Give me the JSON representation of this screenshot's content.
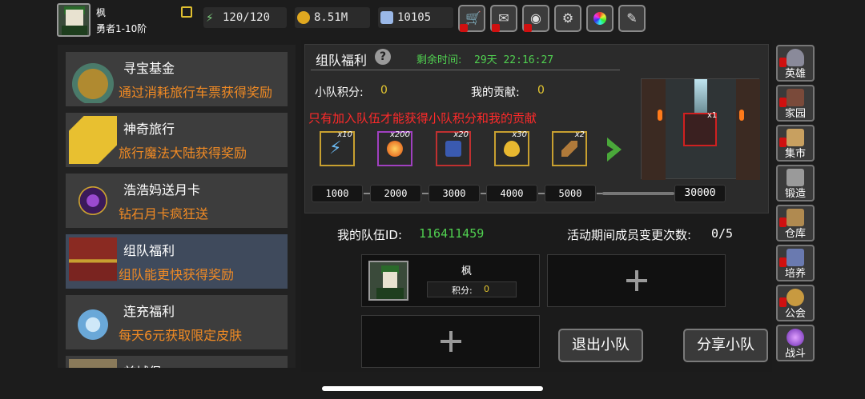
{
  "player": {
    "name": "枫",
    "rank": "勇者1-10阶"
  },
  "resources": {
    "energy": "120/120",
    "gold": "8.51M",
    "gems": "10105"
  },
  "colors": {
    "accent_orange": "#f08a24",
    "green": "#50d050",
    "gold": "#e6c830",
    "red": "#ff2a2a"
  },
  "sidebar": {
    "items": [
      {
        "title": "寻宝基金",
        "desc": "通过消耗旅行车票获得奖励"
      },
      {
        "title": "神奇旅行",
        "desc": "旅行魔法大陆获得奖励"
      },
      {
        "title": "浩浩妈送月卡",
        "desc": "钻石月卡疯狂送"
      },
      {
        "title": "组队福利",
        "desc": "组队能更快获得奖励"
      },
      {
        "title": "连充福利",
        "desc": "每天6元获取限定皮肤"
      },
      {
        "title": "首城堡",
        "desc": ""
      }
    ]
  },
  "panel": {
    "title": "组队福利",
    "timer_label": "剩余时间:",
    "timer": "29天 22:16:27",
    "team_score_label": "小队积分:",
    "team_score": "0",
    "my_contrib_label": "我的贡献:",
    "my_contrib": "0",
    "warning": "只有加入队伍才能获得小队积分和我的贡献",
    "rewards": [
      {
        "icon": "lightning-icon",
        "count": "x10"
      },
      {
        "icon": "fire-orb-icon",
        "count": "x200"
      },
      {
        "icon": "blue-gem-icon",
        "count": "x20"
      },
      {
        "icon": "golden-egg-icon",
        "count": "x30"
      },
      {
        "icon": "scroll-icon",
        "count": "x2"
      }
    ],
    "milestones": [
      "1000",
      "2000",
      "3000",
      "4000",
      "5000"
    ],
    "final_milestone": "30000",
    "final_reward_count": "x1"
  },
  "team": {
    "id_label": "我的队伍ID:",
    "id": "116411459",
    "changes_label": "活动期间成员变更次数:",
    "changes": "0/5",
    "member": {
      "name": "枫",
      "score_label": "积分:",
      "score": "0"
    },
    "leave_button": "退出小队",
    "share_button": "分享小队"
  },
  "side_menu": [
    "英雄",
    "家园",
    "集市",
    "锻造",
    "仓库",
    "培养",
    "公会",
    "战斗"
  ]
}
